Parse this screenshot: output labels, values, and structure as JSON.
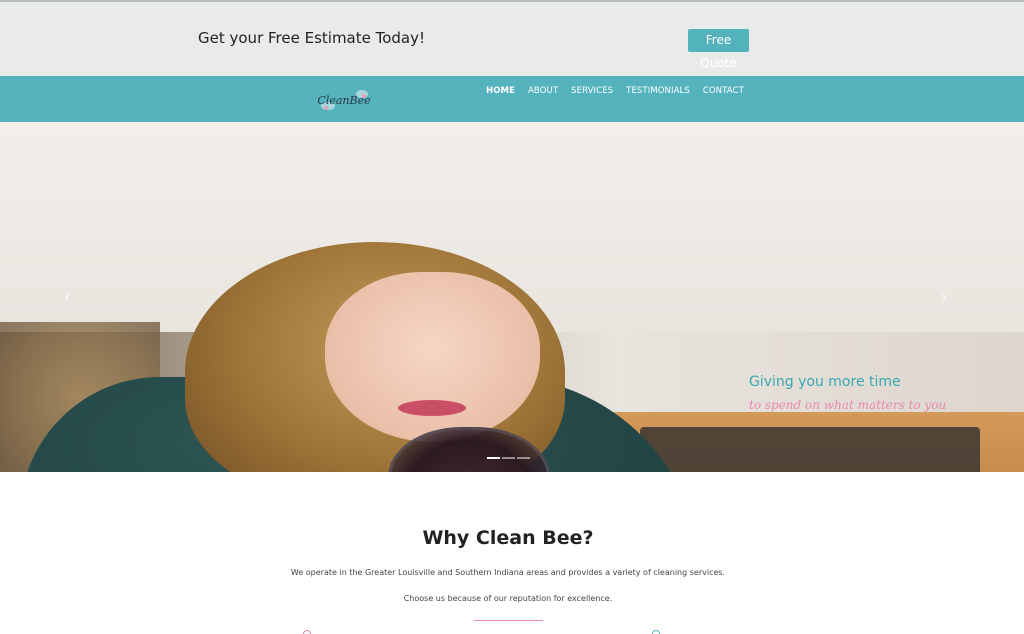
{
  "topbar": {
    "tagline": "Get your Free Estimate Today!",
    "quote_button": "Free Quote"
  },
  "brand": {
    "logo_text": "CleanBee",
    "accent_color": "#55b3bd",
    "pink_color": "#ea8ab0"
  },
  "nav": {
    "items": [
      {
        "label": "HOME",
        "active": true
      },
      {
        "label": "ABOUT"
      },
      {
        "label": "SERVICES"
      },
      {
        "label": "TESTIMONIALS"
      },
      {
        "label": "CONTACT"
      }
    ]
  },
  "carousel": {
    "caption_title": "Giving you more time",
    "caption_sub": "to spend on what matters to you",
    "prev_icon": "‹",
    "next_icon": "›",
    "slides": 3,
    "active_slide": 1
  },
  "why": {
    "title": "Why Clean Bee?",
    "p1": "We operate in the Greater Louisville and Southern Indiana areas and provides a variety of cleaning services.",
    "p2": "Choose us because of our reputation for excellence."
  }
}
